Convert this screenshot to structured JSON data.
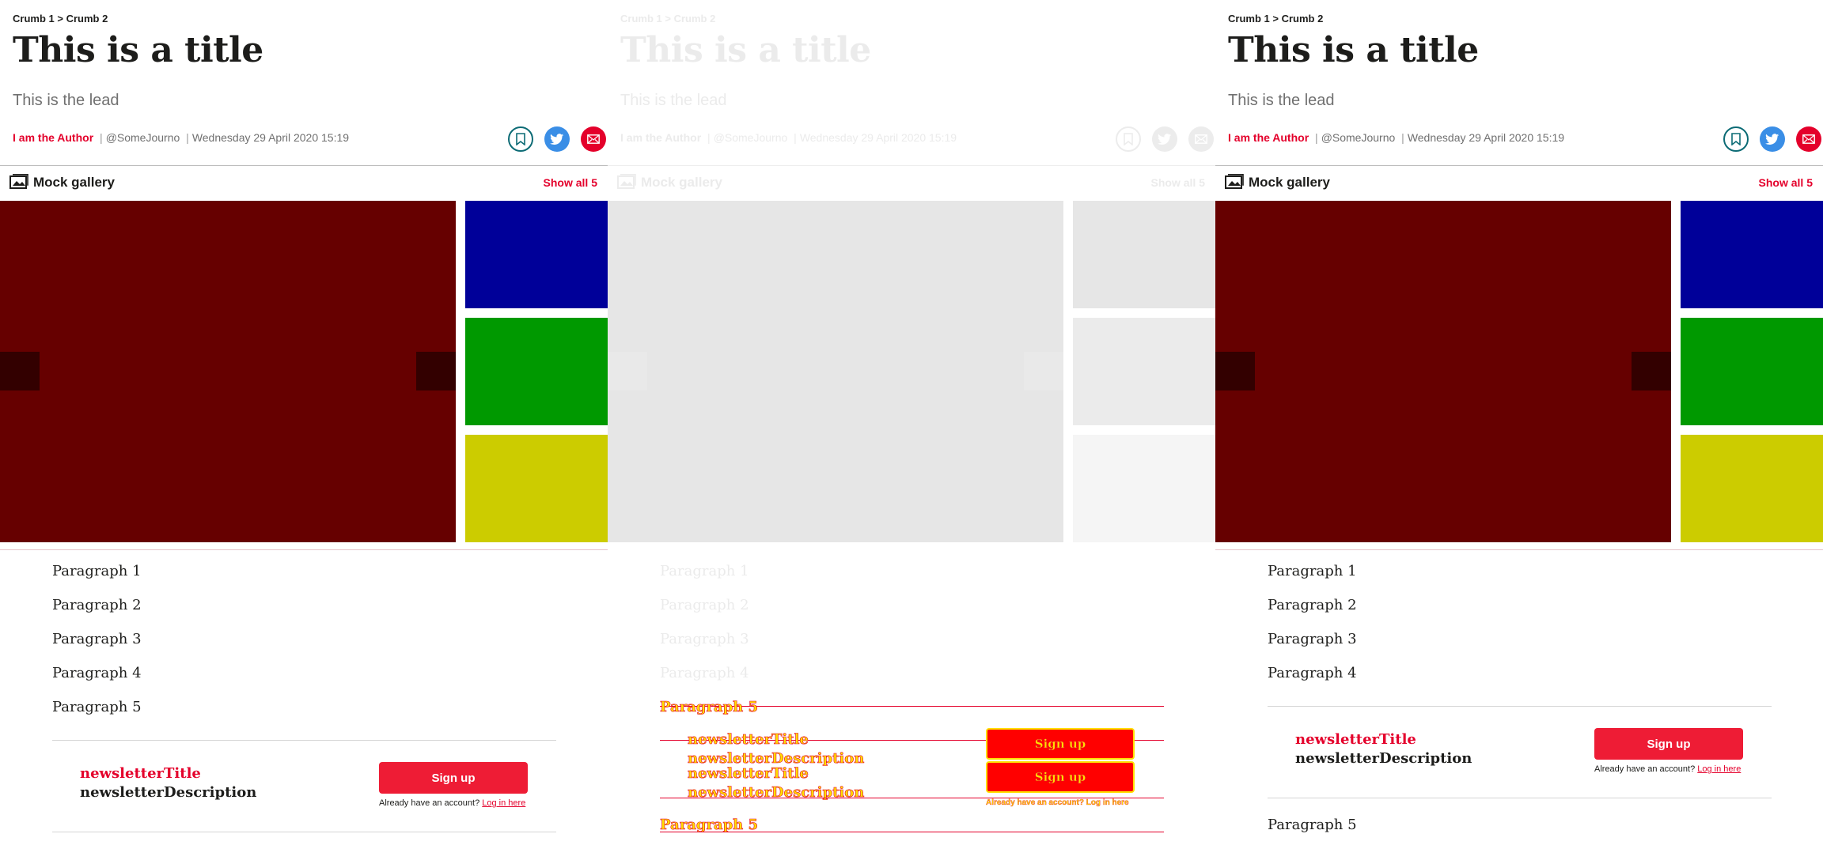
{
  "article": {
    "breadcrumb": [
      "Crumb 1",
      "Crumb 2"
    ],
    "breadcrumb_separator": ">",
    "title": "This is a title",
    "lead": "This is the lead",
    "author": "I am the Author",
    "twitter_handle": "@SomeJourno",
    "date": "Wednesday 29 April 2020 15:19",
    "byline_separator": "|"
  },
  "share": {
    "icons": [
      "bookmark-icon",
      "twitter-icon",
      "email-icon"
    ]
  },
  "gallery": {
    "label": "Mock gallery",
    "show_all": "Show all 5",
    "slide_colors": [
      "#660000",
      "#000099",
      "#009900",
      "#cccc00"
    ],
    "loading_colors": [
      "#e6e6e6",
      "#e6e6e6",
      "#ebebeb",
      "#f5f5f5"
    ]
  },
  "paragraphs": [
    "Paragraph 1",
    "Paragraph 2",
    "Paragraph 3",
    "Paragraph 4",
    "Paragraph 5"
  ],
  "newsletter": {
    "title": "newsletterTitle",
    "description": "newsletterDescription",
    "button": "Sign up",
    "login_prompt": "Already have an account?",
    "login_link": "Log in here"
  },
  "colors": {
    "accent": "#e4002b",
    "twitter": "#3a8ee6",
    "bookmark": "#0c6b75",
    "text": "#1d1d1b",
    "muted": "#707070"
  }
}
